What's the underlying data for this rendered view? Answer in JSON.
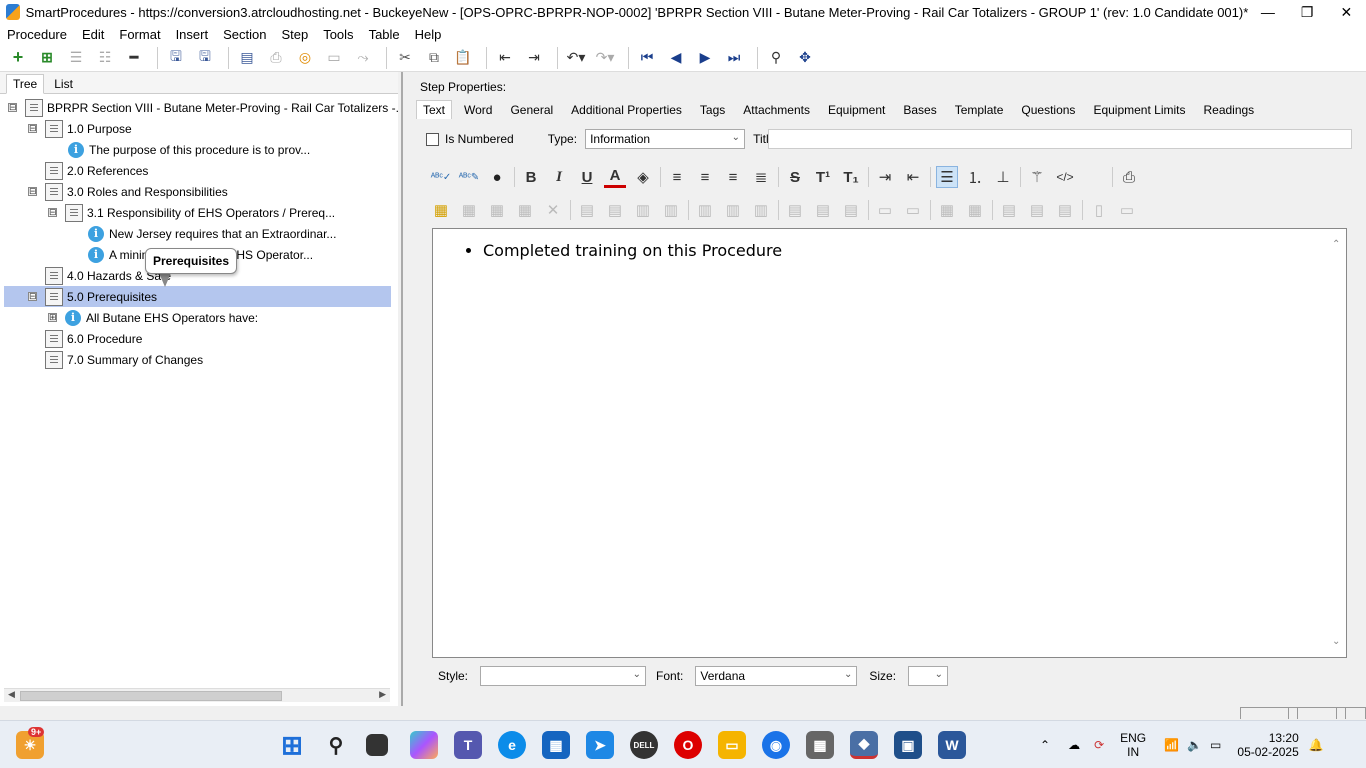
{
  "window": {
    "title": "SmartProcedures - https://conversion3.atrcloudhosting.net - BuckeyeNew - [OPS-OPRC-BPRPR-NOP-0002] 'BPRPR Section VIII - Butane Meter-Proving - Rail Car Totalizers - GROUP 1' (rev: 1.0 Candidate 001)*",
    "minimize": "—",
    "maximize": "❐",
    "close": "✕"
  },
  "menu": [
    "Procedure",
    "Edit",
    "Format",
    "Insert",
    "Section",
    "Step",
    "Tools",
    "Table",
    "Help"
  ],
  "left_tabs": [
    "Tree",
    "List"
  ],
  "tree": [
    {
      "label": "BPRPR Section VIII - Butane Meter-Proving - Rail Car Totalizers -...",
      "expander": "⊟",
      "icon": "doc"
    },
    {
      "label": "1.0 Purpose",
      "expander": "⊟",
      "icon": "doc"
    },
    {
      "label": "The purpose of this procedure is to prov...",
      "expander": "",
      "icon": "info"
    },
    {
      "label": "2.0 References",
      "expander": "",
      "icon": "doc"
    },
    {
      "label": "3.0 Roles and Responsibilities",
      "expander": "⊟",
      "icon": "doc"
    },
    {
      "label": "3.1 Responsibility of EHS Operators / Prereq...",
      "expander": "⊟",
      "icon": "doc"
    },
    {
      "label": "New Jersey requires that an Extraordinar...",
      "expander": "",
      "icon": "info"
    },
    {
      "label": "A minim                  he EHS Operator...",
      "expander": "",
      "icon": "info"
    },
    {
      "label": "4.0 Hazards & Safe",
      "expander": "",
      "icon": "doc"
    },
    {
      "label": "5.0 Prerequisites",
      "expander": "⊟",
      "icon": "doc",
      "selected": true
    },
    {
      "label": "All Butane EHS Operators have:",
      "expander": "⊞",
      "icon": "info"
    },
    {
      "label": "6.0 Procedure",
      "expander": "",
      "icon": "doc"
    },
    {
      "label": "7.0 Summary of Changes",
      "expander": "",
      "icon": "doc"
    }
  ],
  "tooltip": "Prerequisites",
  "step_properties": {
    "heading": "Step Properties:",
    "tabs": [
      "Text",
      "Word",
      "General",
      "Additional Properties",
      "Tags",
      "Attachments",
      "Equipment",
      "Bases",
      "Template",
      "Questions",
      "Equipment Limits",
      "Readings"
    ],
    "is_numbered_label": "Is Numbered",
    "type_label": "Type:",
    "type_value": "Information",
    "title_label": "Title:",
    "title_value": ""
  },
  "editor": {
    "bullets": [
      "Completed training on this Procedure"
    ]
  },
  "bottom": {
    "style_label": "Style:",
    "style_value": "",
    "font_label": "Font:",
    "font_value": "Verdana",
    "size_label": "Size:",
    "size_value": ""
  },
  "taskbar": {
    "notification_badge": "9+",
    "lang_primary": "ENG",
    "lang_secondary": "IN",
    "time": "13:20",
    "date": "05-02-2025"
  },
  "colors": {
    "selection": "#b4c6ee",
    "info_icon": "#3da1e0"
  }
}
